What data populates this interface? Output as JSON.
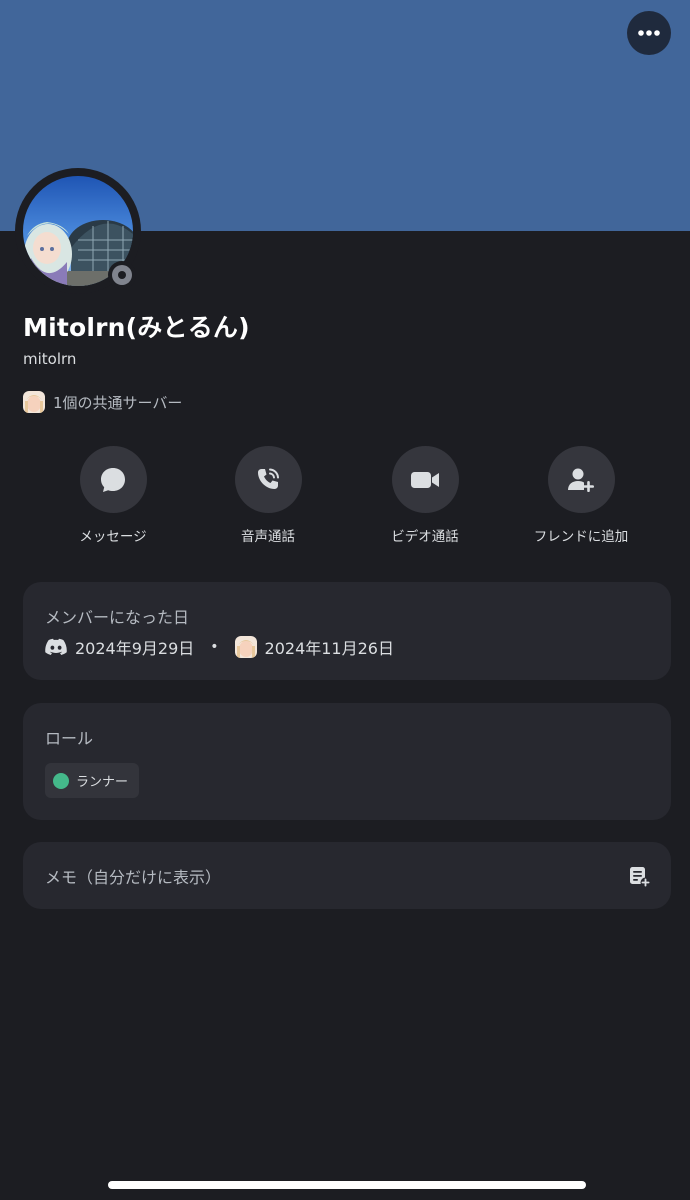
{
  "profile": {
    "display_name": "Mitolrn(みとるん)",
    "username": "mitolrn",
    "mutual_servers": "1個の共通サーバー",
    "status": "offline"
  },
  "header": {
    "more_icon": "more-horizontal-icon",
    "banner_color": "#41669a"
  },
  "actions": [
    {
      "label": "メッセージ",
      "icon": "chat-bubble-icon"
    },
    {
      "label": "音声通話",
      "icon": "phone-call-icon"
    },
    {
      "label": "ビデオ通話",
      "icon": "video-camera-icon"
    },
    {
      "label": "フレンドに追加",
      "icon": "add-friend-icon"
    }
  ],
  "member_since": {
    "title": "メンバーになった日",
    "discord_date": "2024年9月29日",
    "separator": "•",
    "server_date": "2024年11月26日"
  },
  "roles": {
    "title": "ロール",
    "items": [
      {
        "label": "ランナー",
        "color": "#44b88a"
      }
    ]
  },
  "note": {
    "title": "メモ（自分だけに表示）",
    "icon": "note-add-icon"
  }
}
